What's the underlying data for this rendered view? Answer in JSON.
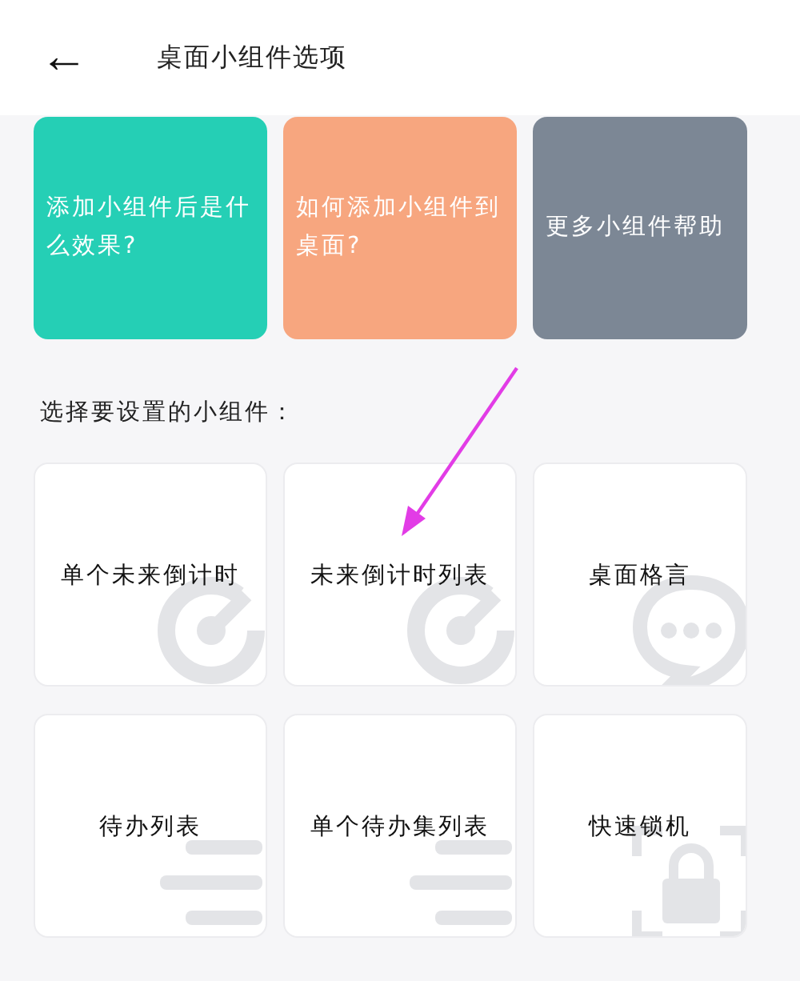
{
  "header": {
    "back_icon": "←",
    "title": "桌面小组件选项"
  },
  "help_cards": [
    {
      "label": "添加小组件后是什么效果?",
      "color": "#25cfb5"
    },
    {
      "label": "如何添加小组件到桌面?",
      "color": "#f7a67f"
    },
    {
      "label": "更多小组件帮助",
      "color": "#7c8795"
    }
  ],
  "section_label": "选择要设置的小组件：",
  "widgets": [
    {
      "label": "单个未来倒计时",
      "kind": "target"
    },
    {
      "label": "未来倒计时列表",
      "kind": "target"
    },
    {
      "label": "桌面格言",
      "kind": "chat"
    },
    {
      "label": "待办列表",
      "kind": "list"
    },
    {
      "label": "单个待办集列表",
      "kind": "list"
    },
    {
      "label": "快速锁机",
      "kind": "lock"
    }
  ]
}
